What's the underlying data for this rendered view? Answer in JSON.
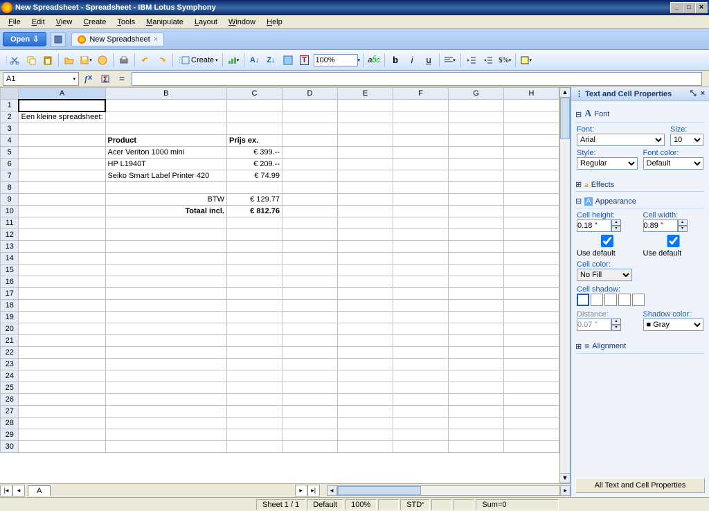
{
  "window": {
    "title": "New Spreadsheet - Spreadsheet - IBM Lotus Symphony"
  },
  "menu": [
    "File",
    "Edit",
    "View",
    "Create",
    "Tools",
    "Manipulate",
    "Layout",
    "Window",
    "Help"
  ],
  "tabbar": {
    "open": "Open",
    "doc_tab": "New Spreadsheet"
  },
  "toolbar": {
    "create": "Create",
    "zoom": "100%"
  },
  "formula": {
    "cell_ref": "A1"
  },
  "columns": [
    "A",
    "B",
    "C",
    "D",
    "E",
    "F",
    "G",
    "H"
  ],
  "cells": {
    "a2": "Een kleine spreadsheet:",
    "b4": "Product",
    "c4": "Prijs ex.",
    "b5": "Acer Veriton 1000 mini",
    "c5": "€ 399.--",
    "b6": "HP L1940T",
    "c6": "€ 209.--",
    "b7": "Seiko Smart Label Printer 420",
    "c7": "€ 74.99",
    "b9": "BTW",
    "c9": "€ 129.77",
    "b10": "Totaal incl.",
    "c10": "€ 812.76"
  },
  "sheet_tab": "A",
  "props": {
    "title": "Text and Cell Properties",
    "font_section": "Font",
    "font_label": "Font:",
    "font_value": "Arial",
    "size_label": "Size:",
    "size_value": "10",
    "style_label": "Style:",
    "style_value": "Regular",
    "color_label": "Font color:",
    "color_value": "Default",
    "effects_section": "Effects",
    "appearance_section": "Appearance",
    "height_label": "Cell height:",
    "height_value": "0.18 ''",
    "width_label": "Cell width:",
    "width_value": "0.89 ''",
    "use_default": "Use default",
    "cellcolor_label": "Cell color:",
    "cellcolor_value": "No Fill",
    "shadow_label": "Cell shadow:",
    "distance_label": "Distance:",
    "distance_value": "0.07 ''",
    "shadowcolor_label": "Shadow color:",
    "shadowcolor_value": "Gray",
    "alignment_section": "Alignment",
    "footer_btn": "All Text and Cell Properties"
  },
  "status": {
    "sheet": "Sheet 1 / 1",
    "default": "Default",
    "zoom": "100%",
    "std": "STD",
    "sum": "Sum=0"
  }
}
